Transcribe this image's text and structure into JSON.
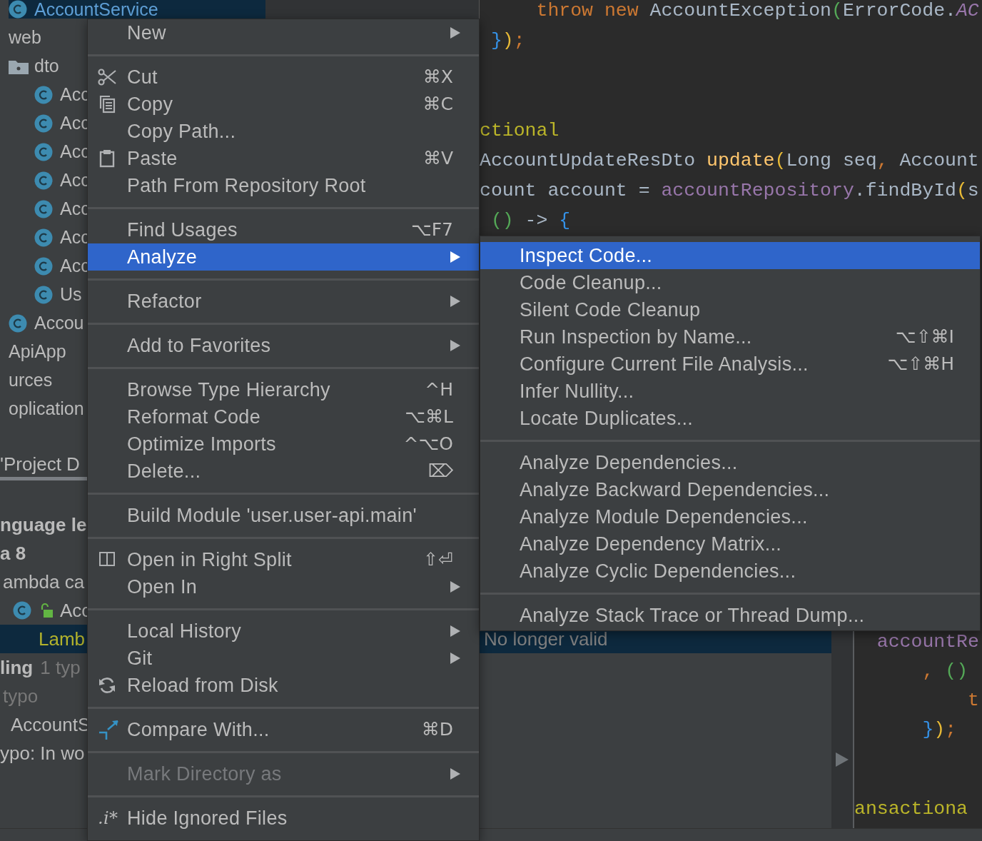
{
  "project_tree": {
    "top_row": {
      "kind": "class",
      "label": "AccountService",
      "selected": true
    },
    "items": [
      {
        "label": "web",
        "selected": false,
        "children": [
          {
            "kind": "folder",
            "label": "dto",
            "selected": false,
            "children": [
              {
                "kind": "class",
                "label": "Acc",
                "selected": false
              },
              {
                "kind": "class",
                "label": "Acc",
                "selected": false
              },
              {
                "kind": "class",
                "label": "Acc",
                "selected": false
              },
              {
                "kind": "class",
                "label": "Acc",
                "selected": false
              },
              {
                "kind": "class",
                "label": "Acc",
                "selected": false
              },
              {
                "kind": "class",
                "label": "Acc",
                "selected": false
              },
              {
                "kind": "class",
                "label": "Acc",
                "selected": false
              },
              {
                "kind": "class",
                "label": "Us",
                "selected": false
              }
            ]
          },
          {
            "kind": "class",
            "label": "Accou",
            "selected": false
          }
        ]
      },
      {
        "label": "ApiApp",
        "selected": false
      },
      {
        "label": "urces",
        "selected": false
      },
      {
        "label": "oplication",
        "selected": false
      }
    ]
  },
  "editor_top": {
    "lines": [
      {
        "kind": "code",
        "tokens": [
          {
            "kind": "keyword",
            "text": "     throw new "
          },
          {
            "kind": "plain",
            "text": "AccountException"
          },
          {
            "kind": "paren_green",
            "text": "("
          },
          {
            "kind": "plain",
            "text": "ErrorCode."
          },
          {
            "kind": "constant",
            "text": "AC"
          }
        ]
      },
      {
        "kind": "code",
        "tokens": [
          {
            "kind": "brace",
            "text": " }"
          },
          {
            "kind": "paren_yellow",
            "text": ")"
          },
          {
            "kind": "punct",
            "text": ";"
          }
        ]
      },
      {
        "kind": "blank"
      },
      {
        "kind": "blank"
      },
      {
        "kind": "code",
        "tokens": [
          {
            "kind": "annotation",
            "text": "ctional"
          }
        ]
      },
      {
        "kind": "code",
        "tokens": [
          {
            "kind": "plain",
            "text": "AccountUpdateResDto "
          },
          {
            "kind": "method",
            "text": "update"
          },
          {
            "kind": "paren_yellow",
            "text": "("
          },
          {
            "kind": "plain",
            "text": "Long seq"
          },
          {
            "kind": "punct",
            "text": ", "
          },
          {
            "kind": "plain",
            "text": "Account"
          }
        ]
      },
      {
        "kind": "code",
        "tokens": [
          {
            "kind": "plain",
            "text": "count account = "
          },
          {
            "kind": "field",
            "text": "accountRepository"
          },
          {
            "kind": "plain",
            "text": ".findById"
          },
          {
            "kind": "paren_yellow",
            "text": "("
          },
          {
            "kind": "plain",
            "text": "s"
          }
        ]
      },
      {
        "kind": "code",
        "tokens": [
          {
            "kind": "paren_green",
            "text": " ()"
          },
          {
            "kind": "plain",
            "text": " -> "
          },
          {
            "kind": "brace",
            "text": "{"
          }
        ]
      }
    ]
  },
  "context_menu": {
    "items": [
      {
        "kind": "item",
        "label": "New",
        "submenu": true,
        "selected": false,
        "disabled": false
      },
      {
        "kind": "separator"
      },
      {
        "kind": "cut",
        "label": "Cut",
        "shortcut": "⌘X",
        "submenu": false,
        "selected": false,
        "disabled": false
      },
      {
        "kind": "copy",
        "label": "Copy",
        "shortcut": "⌘C",
        "submenu": false,
        "selected": false,
        "disabled": false
      },
      {
        "kind": "item",
        "label": "Copy Path...",
        "submenu": false,
        "selected": false,
        "disabled": false
      },
      {
        "kind": "paste",
        "label": "Paste",
        "shortcut": "⌘V",
        "submenu": false,
        "selected": false,
        "disabled": false
      },
      {
        "kind": "item",
        "label": "Path From Repository Root",
        "submenu": false,
        "selected": false,
        "disabled": false
      },
      {
        "kind": "separator"
      },
      {
        "kind": "item",
        "label": "Find Usages",
        "shortcut": "⌥F7",
        "submenu": false,
        "selected": false,
        "disabled": false
      },
      {
        "kind": "item",
        "label": "Analyze",
        "submenu": true,
        "selected": true,
        "disabled": false
      },
      {
        "kind": "separator"
      },
      {
        "kind": "item",
        "label": "Refactor",
        "submenu": true,
        "selected": false,
        "disabled": false
      },
      {
        "kind": "separator"
      },
      {
        "kind": "item",
        "label": "Add to Favorites",
        "submenu": true,
        "selected": false,
        "disabled": false
      },
      {
        "kind": "separator"
      },
      {
        "kind": "item",
        "label": "Browse Type Hierarchy",
        "shortcut": "^H",
        "submenu": false,
        "selected": false,
        "disabled": false
      },
      {
        "kind": "item",
        "label": "Reformat Code",
        "shortcut": "⌥⌘L",
        "submenu": false,
        "selected": false,
        "disabled": false
      },
      {
        "kind": "item",
        "label": "Optimize Imports",
        "shortcut": "^⌥O",
        "submenu": false,
        "selected": false,
        "disabled": false
      },
      {
        "kind": "item",
        "label": "Delete...",
        "shortcut": "⌦",
        "submenu": false,
        "selected": false,
        "disabled": false
      },
      {
        "kind": "separator"
      },
      {
        "kind": "item",
        "label": "Build Module 'user.user-api.main'",
        "submenu": false,
        "selected": false,
        "disabled": false
      },
      {
        "kind": "separator"
      },
      {
        "kind": "split",
        "label": "Open in Right Split",
        "shortcut": "⇧⏎",
        "submenu": false,
        "selected": false,
        "disabled": false
      },
      {
        "kind": "item",
        "label": "Open In",
        "submenu": true,
        "selected": false,
        "disabled": false
      },
      {
        "kind": "separator"
      },
      {
        "kind": "item",
        "label": "Local History",
        "submenu": true,
        "selected": false,
        "disabled": false
      },
      {
        "kind": "item",
        "label": "Git",
        "submenu": true,
        "selected": false,
        "disabled": false
      },
      {
        "kind": "reload",
        "label": "Reload from Disk",
        "submenu": false,
        "selected": false,
        "disabled": false
      },
      {
        "kind": "separator"
      },
      {
        "kind": "compare",
        "label": "Compare With...",
        "shortcut": "⌘D",
        "submenu": false,
        "selected": false,
        "disabled": false
      },
      {
        "kind": "separator"
      },
      {
        "kind": "item",
        "label": "Mark Directory as",
        "submenu": true,
        "selected": false,
        "disabled": true
      },
      {
        "kind": "separator"
      },
      {
        "kind": "glyph",
        "glyph": ".i*",
        "label": "Hide Ignored Files",
        "submenu": false,
        "selected": false,
        "disabled": false
      }
    ]
  },
  "analyze_submenu": {
    "items": [
      {
        "kind": "item",
        "label": "Inspect Code...",
        "selected": true
      },
      {
        "kind": "item",
        "label": "Code Cleanup...",
        "selected": false
      },
      {
        "kind": "item",
        "label": "Silent Code Cleanup",
        "selected": false
      },
      {
        "kind": "item",
        "label": "Run Inspection by Name...",
        "shortcut": "⌥⇧⌘I",
        "selected": false
      },
      {
        "kind": "item",
        "label": "Configure Current File Analysis...",
        "shortcut": "⌥⇧⌘H",
        "selected": false
      },
      {
        "kind": "item",
        "label": "Infer Nullity...",
        "selected": false
      },
      {
        "kind": "item",
        "label": "Locate Duplicates...",
        "selected": false
      },
      {
        "kind": "separator"
      },
      {
        "kind": "item",
        "label": "Analyze Dependencies...",
        "selected": false
      },
      {
        "kind": "item",
        "label": "Analyze Backward Dependencies...",
        "selected": false
      },
      {
        "kind": "item",
        "label": "Analyze Module Dependencies...",
        "selected": false
      },
      {
        "kind": "item",
        "label": "Analyze Dependency Matrix...",
        "selected": false
      },
      {
        "kind": "item",
        "label": "Analyze Cyclic Dependencies...",
        "selected": false
      },
      {
        "kind": "separator"
      },
      {
        "kind": "item",
        "label": "Analyze Stack Trace or Thread Dump...",
        "selected": false
      }
    ]
  },
  "problems_panel": {
    "tab": {
      "label": "'Project D",
      "selected": true
    },
    "rows": [
      {
        "kind": "category",
        "label": "nguage le",
        "muted": false,
        "selected": false
      },
      {
        "kind": "category",
        "label": "a 8",
        "muted": false,
        "selected": false
      },
      {
        "kind": "inspection",
        "label": "ambda ca",
        "muted": false,
        "selected": false
      },
      {
        "kind": "class",
        "label": "Acc",
        "muted": false,
        "selected": false
      },
      {
        "kind": "problem",
        "label": "Lamb",
        "note": "No longer valid",
        "muted": false,
        "selected": true
      },
      {
        "kind": "category",
        "label": "ling",
        "count": "1 typ",
        "muted": false,
        "selected": false
      },
      {
        "kind": "inspection",
        "label": "typo",
        "muted": true,
        "selected": false
      },
      {
        "kind": "file",
        "label": "AccountS",
        "muted": false,
        "selected": false
      },
      {
        "kind": "description",
        "label": "ypo: In wo",
        "muted": false,
        "selected": false
      }
    ]
  },
  "editor_bottom": {
    "lines": [
      {
        "kind": "code",
        "tokens": [
          {
            "kind": "field",
            "text": "  accountRe"
          }
        ]
      },
      {
        "kind": "code",
        "tokens": [
          {
            "kind": "punct",
            "text": "      ,"
          },
          {
            "kind": "paren_green",
            "text": " ()"
          }
        ]
      },
      {
        "kind": "code",
        "tokens": [
          {
            "kind": "keyword",
            "text": "          t"
          }
        ]
      },
      {
        "kind": "code",
        "tokens": [
          {
            "kind": "brace",
            "text": "      }"
          },
          {
            "kind": "paren_yellow",
            "text": ")"
          },
          {
            "kind": "punct",
            "text": ";"
          }
        ]
      },
      {
        "kind": "blank",
        "gutter_arrow": true
      },
      {
        "kind": "blank"
      },
      {
        "kind": "code",
        "tokens": [
          {
            "kind": "annotation",
            "text": "ansactiona"
          }
        ]
      }
    ]
  }
}
